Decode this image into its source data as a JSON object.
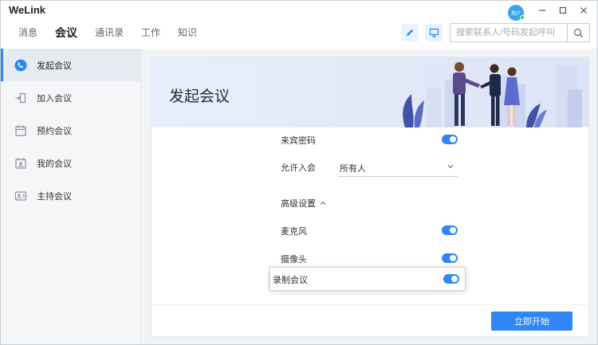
{
  "app": {
    "name": "WeLink"
  },
  "nav": {
    "items": [
      {
        "label": "消息"
      },
      {
        "label": "会议"
      },
      {
        "label": "通讯录"
      },
      {
        "label": "工作"
      },
      {
        "label": "知识"
      }
    ],
    "active_index": 1
  },
  "avatar": {
    "label": "用户",
    "status_color": "#2ecc71"
  },
  "search": {
    "placeholder": "搜索联系人/号码发起呼叫",
    "value": ""
  },
  "sidebar": {
    "items": [
      {
        "label": "发起会议",
        "icon": "phone-icon",
        "active": true
      },
      {
        "label": "加入会议",
        "icon": "enter-door-icon",
        "active": false
      },
      {
        "label": "预约会议",
        "icon": "calendar-icon",
        "active": false
      },
      {
        "label": "我的会议",
        "icon": "calendar-person-icon",
        "active": false
      },
      {
        "label": "主持会议",
        "icon": "host-icon",
        "active": false
      }
    ]
  },
  "main": {
    "title": "发起会议",
    "rows": {
      "guest_password": {
        "label": "来宾密码",
        "on": true
      },
      "allow_join": {
        "label": "允许入会",
        "value": "所有人"
      },
      "advanced": {
        "label": "高级设置"
      },
      "microphone": {
        "label": "麦克风",
        "on": true
      },
      "camera": {
        "label": "摄像头",
        "on": true
      },
      "record": {
        "label": "录制会议",
        "on": true
      }
    },
    "start_button": "立即开始"
  },
  "colors": {
    "accent": "#2f86f6",
    "sidebar_bg": "#f5f6f8",
    "banner_bg": "#e6ebf8"
  }
}
